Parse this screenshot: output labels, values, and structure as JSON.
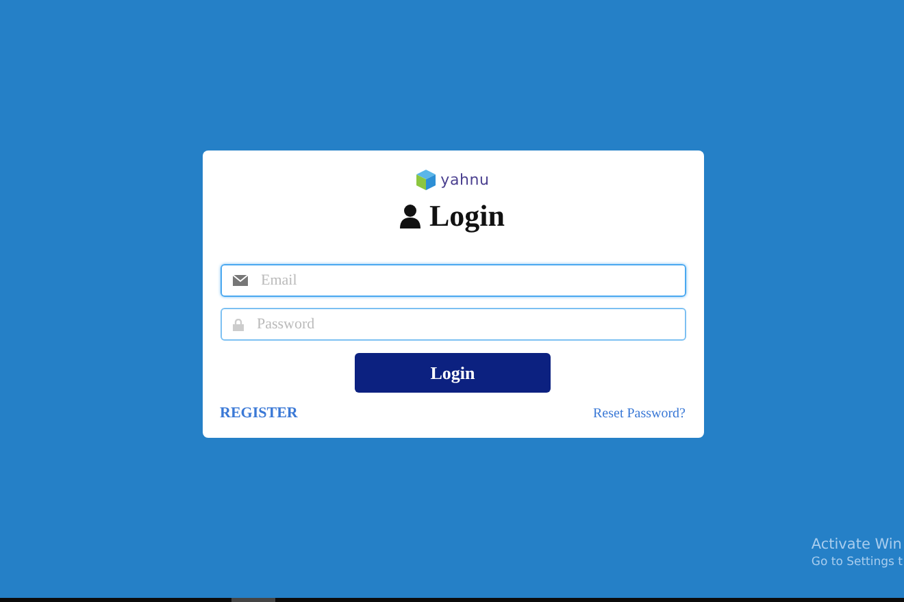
{
  "logo": {
    "text": "yahnu"
  },
  "heading": "Login",
  "fields": [
    {
      "kind": "email",
      "placeholder": "Email",
      "focused": true
    },
    {
      "kind": "password",
      "placeholder": "Password",
      "focused": false
    }
  ],
  "submit_button": "Login",
  "links": {
    "register": "REGISTER",
    "reset": "Reset Password?"
  },
  "activation_notice": {
    "title": "Activate Win",
    "subtitle": "Go to Settings t"
  }
}
